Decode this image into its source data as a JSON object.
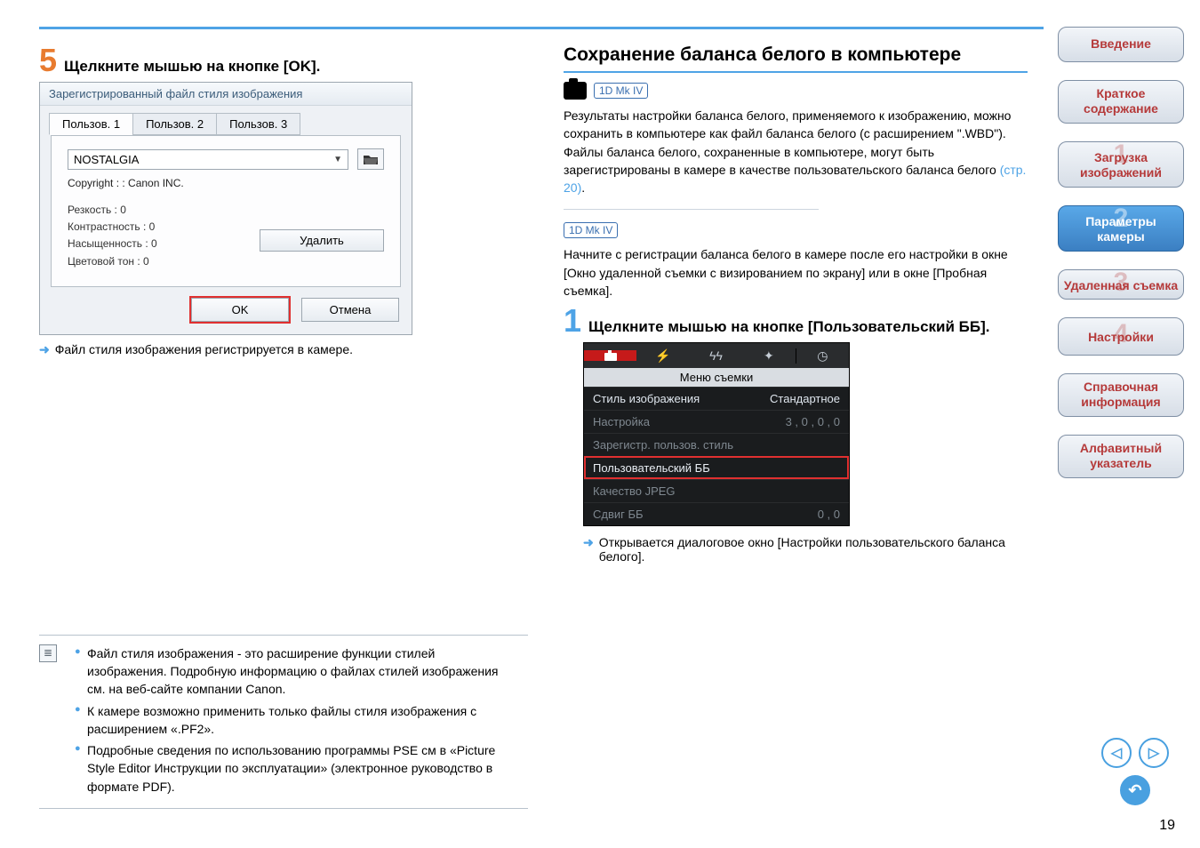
{
  "left": {
    "step5_num": "5",
    "step5_title": "Щелкните мышью на кнопке [OK].",
    "dialog": {
      "title": "Зарегистрированный файл стиля изображения",
      "tabs": [
        "Пользов. 1",
        "Пользов. 2",
        "Пользов. 3"
      ],
      "combo_value": "NOSTALGIA",
      "copyright": "Copyright : : Canon INC.",
      "params": {
        "p1": "Резкость : 0",
        "p2": "Контрастность : 0",
        "p3": "Насыщенность : 0",
        "p4": "Цветовой тон : 0"
      },
      "delete": "Удалить",
      "ok": "OK",
      "cancel": "Отмена"
    },
    "result_text": "Файл стиля изображения регистрируется в камере.",
    "notes": {
      "n1": "Файл стиля изображения - это расширение функции стилей изображения. Подробную информацию о файлах стилей изображения см. на веб-сайте компании Canon.",
      "n2": "К камере возможно применить только файлы стиля изображения с расширением «.PF2».",
      "n3": "Подробные сведения по использованию программы PSE см в «Picture Style Editor Инструкции по эксплуатации» (электронное руководство в формате PDF)."
    }
  },
  "right": {
    "h2": "Сохранение баланса белого в компьютере",
    "badge": "1D Mk IV",
    "para1": "Результаты настройки баланса белого, применяемого к изображению, можно сохранить в компьютере как файл баланса белого (с расширением \".WBD\"). Файлы баланса белого, сохраненные в компьютере, могут быть зарегистрированы в камере в качестве пользовательского баланса белого ",
    "para1_link": "(стр. 20)",
    "para1_tail": ".",
    "para2": "Начните с регистрации баланса белого в камере после его настройки в окне [Окно удаленной съемки с визированием по экрану] или в окне [Пробная съемка].",
    "step1_num": "1",
    "step1_title": "Щелкните мышью на кнопке [Пользовательский ББ].",
    "menu": {
      "header": "Меню съемки",
      "r1l": "Стиль изображения",
      "r1r": "Стандартное",
      "r2l": "Настройка",
      "r2r": "3 , 0 , 0 , 0",
      "r3l": "Зарегистр. пользов. стиль",
      "r3r": "",
      "r4l": "Пользовательский ББ",
      "r4r": "",
      "r5l": "Качество JPEG",
      "r5r": "",
      "r6l": "Сдвиг ББ",
      "r6r": "0 , 0"
    },
    "result1a": "Открывается диалоговое окно [Настройки пользовательского баланса белого]."
  },
  "nav": {
    "b1": "Введение",
    "b2": "Краткое содержание",
    "b3": "Загрузка изображений",
    "b4": "Параметры камеры",
    "b5": "Удаленная съемка",
    "b6": "Настройки",
    "b7": "Справочная информация",
    "b8": "Алфавитный указатель",
    "g1": "1",
    "g2": "2",
    "g3": "3",
    "g4": "4"
  },
  "page_number": "19"
}
